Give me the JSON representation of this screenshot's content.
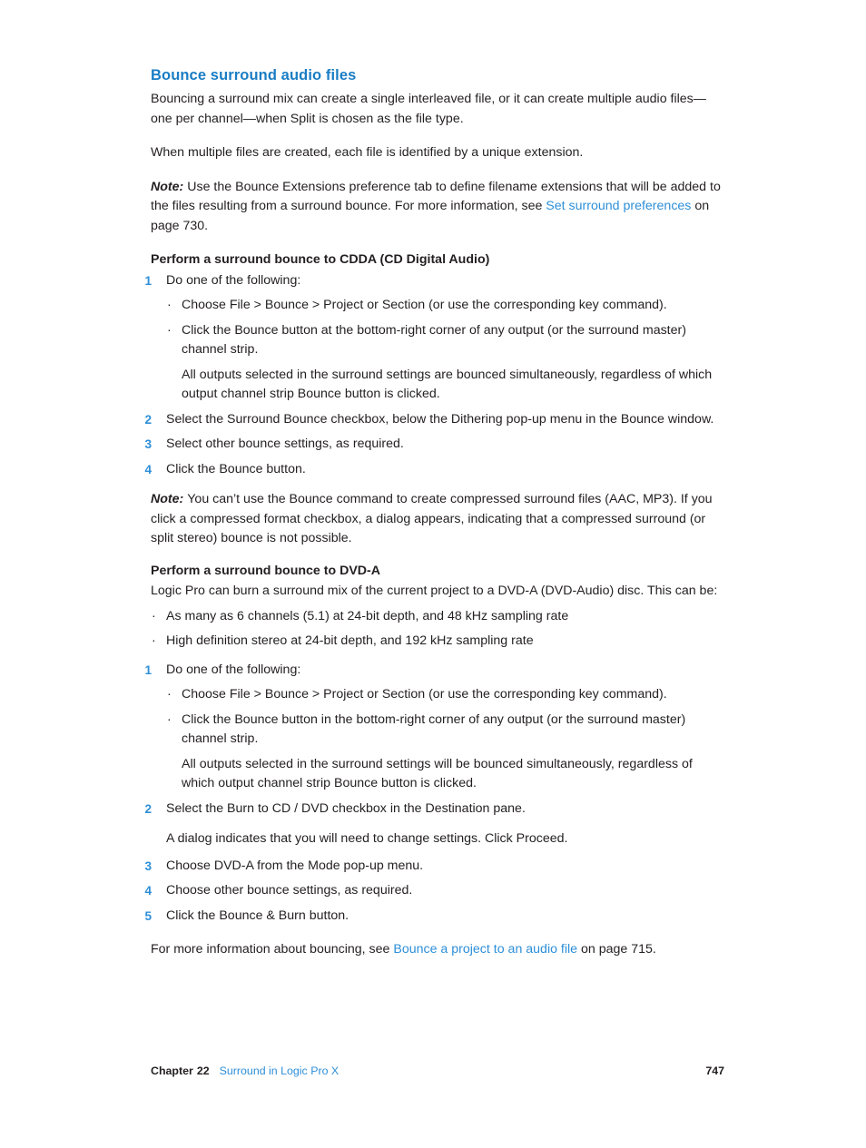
{
  "colors": {
    "heading_blue": "#1a7dc4",
    "link_blue": "#2e8fd8",
    "body_text": "#231f20",
    "page_background": "#ffffff"
  },
  "heading": "Bounce surround audio files",
  "intro": {
    "para1": "Bouncing a surround mix can create a single interleaved file, or it can create multiple audio files—one per channel—when Split is chosen as the file type.",
    "para2": "When multiple files are created, each file is identified by a unique extension.",
    "note": {
      "label": "Note:",
      "text_before_link": "Use the Bounce Extensions preference tab to define filename extensions that will be added to the files resulting from a surround bounce. For more information, see ",
      "link": "Set surround preferences",
      "text_after_link": " on page 730."
    }
  },
  "cdda_section": {
    "title": "Perform a surround bounce to CDDA (CD Digital Audio)",
    "steps": [
      {
        "num": "1",
        "text": "Do one of the following:",
        "bullets": [
          "Choose File > Bounce > Project or Section (or use the corresponding key command).",
          "Click the Bounce button at the bottom-right corner of any output (or the surround master) channel strip."
        ],
        "sub_note": "All outputs selected in the surround settings are bounced simultaneously, regardless of which output channel strip Bounce button is clicked."
      },
      {
        "num": "2",
        "text": "Select the Surround Bounce checkbox, below the Dithering pop-up menu in the Bounce window."
      },
      {
        "num": "3",
        "text": "Select other bounce settings, as required."
      },
      {
        "num": "4",
        "text": "Click the Bounce button."
      }
    ],
    "note": {
      "label": "Note:",
      "text": "You can’t use the Bounce command to create compressed surround files (AAC, MP3). If you click a compressed format checkbox, a dialog appears, indicating that a compressed surround (or split stereo) bounce is not possible."
    }
  },
  "dvda_section": {
    "title": "Perform a surround bounce to DVD-A",
    "intro": "Logic Pro can burn a surround mix of the current project to a DVD-A (DVD-Audio) disc. This can be:",
    "capabilities": [
      "As many as 6 channels (5.1) at 24-bit depth, and 48 kHz sampling rate",
      "High definition stereo at 24-bit depth, and 192 kHz sampling rate"
    ],
    "steps": [
      {
        "num": "1",
        "text": "Do one of the following:",
        "bullets": [
          "Choose File > Bounce > Project or Section (or use the corresponding key command).",
          "Click the Bounce button in the bottom-right corner of any output (or the surround master) channel strip."
        ],
        "sub_note": "All outputs selected in the surround settings will be bounced simultaneously, regardless of which output channel strip Bounce button is clicked."
      },
      {
        "num": "2",
        "text": "Select the Burn to CD / DVD checkbox in the Destination pane.",
        "sub_note": "A dialog indicates that you will need to change settings. Click Proceed."
      },
      {
        "num": "3",
        "text": "Choose DVD-A from the Mode pop-up menu."
      },
      {
        "num": "4",
        "text": "Choose other bounce settings, as required."
      },
      {
        "num": "5",
        "text": "Click the Bounce & Burn button."
      }
    ],
    "closing": {
      "text_before_link": "For more information about bouncing, see ",
      "link": "Bounce a project to an audio file",
      "text_after_link": " on page 715."
    }
  },
  "footer": {
    "chapter_label": "Chapter",
    "chapter_number": "22",
    "chapter_title": "Surround in Logic Pro X",
    "page_number": "747"
  }
}
